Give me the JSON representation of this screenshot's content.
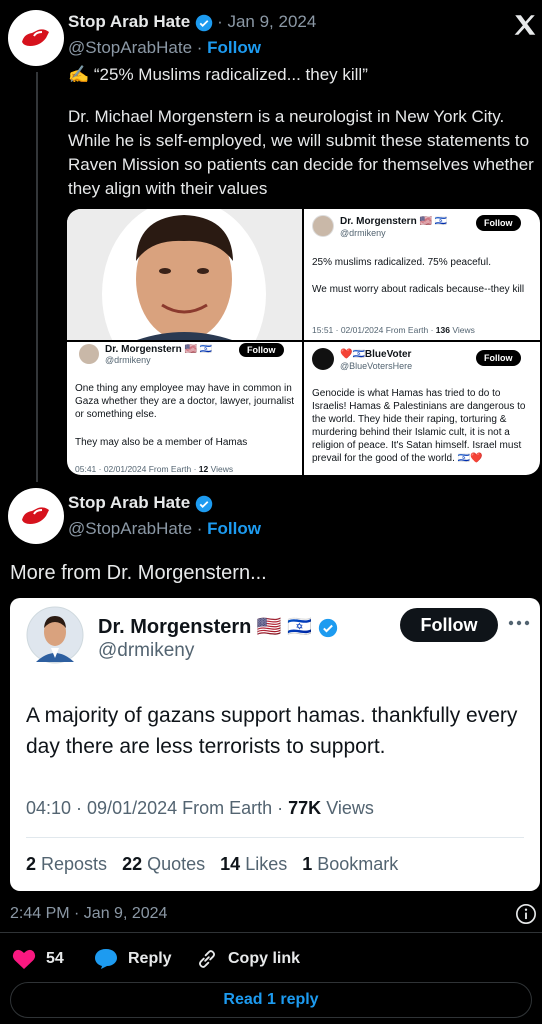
{
  "post1": {
    "name": "Stop Arab Hate",
    "date": "Jan 9, 2024",
    "handle": "@StopArabHate",
    "follow": "Follow",
    "line1": "✍️ “25% Muslims radicalized... they kill”",
    "line2": "Dr. Michael Morgenstern is a neurologist in New York City. While he is self-employed, we will submit these statements to Raven Mission so patients can decide for themselves whether they align with their values"
  },
  "grid": {
    "cell_b": {
      "name": "Dr. Morgenstern 🇺🇸 🇮🇱",
      "handle": "@drmikeny",
      "follow": "Follow",
      "text1": "25% muslims radicalized. 75% peaceful.",
      "text2": "We must worry about radicals because--they kill",
      "meta": "15:51 · 02/01/2024 From Earth · ",
      "views_num": "136",
      "views_label": " Views"
    },
    "cell_c": {
      "name": "Dr. Morgenstern 🇺🇸 🇮🇱",
      "handle": "@drmikeny",
      "follow": "Follow",
      "text1": "One thing any employee may have in common in Gaza whether they are a doctor, lawyer, journalist or something else.",
      "text2": "They may also be a member of Hamas",
      "meta": "05:41 · 02/01/2024 From Earth · ",
      "views_num": "12",
      "views_label": " Views"
    },
    "cell_d": {
      "name": "❤️🇮🇱BlueVoter",
      "handle": "@BlueVotersHere",
      "follow": "Follow",
      "text": "Genocide is what Hamas has tried to do to Israelis! Hamas & Palestinians are dangerous to the world. They hide their raping, torturing & murdering behind their Islamic cult, it is not a religion of peace. It's Satan himself. Israel must prevail for the good of the world. 🇮🇱❤️"
    }
  },
  "post2": {
    "name": "Stop Arab Hate",
    "handle": "@StopArabHate",
    "follow": "Follow",
    "text": "More from Dr. Morgenstern..."
  },
  "quote": {
    "name": "Dr. Morgenstern 🇺🇸 🇮🇱",
    "handle": "@drmikeny",
    "follow": "Follow",
    "text": "A majority of gazans support hamas. thankfully every day there are less terrorists to support.",
    "meta": "04:10 · 09/01/2024 From Earth · ",
    "views_num": "77K",
    "views_label": " Views",
    "reposts_num": "2",
    "reposts_label": " Reposts",
    "quotes_num": "22",
    "quotes_label": " Quotes",
    "likes_num": "14",
    "likes_label": " Likes",
    "bookmark_num": "1",
    "bookmark_label": " Bookmark"
  },
  "footer": {
    "timestamp": "2:44 PM · Jan 9, 2024",
    "likes": "54",
    "reply": "Reply",
    "copy_link": "Copy link",
    "read_reply": "Read 1 reply"
  },
  "colors": {
    "accent": "#1d9bf0",
    "like": "#f91880",
    "background": "#000000"
  },
  "icons": [
    "x-logo-icon",
    "verified-icon",
    "heart-icon",
    "reply-icon",
    "link-icon",
    "info-icon",
    "more-icon"
  ]
}
